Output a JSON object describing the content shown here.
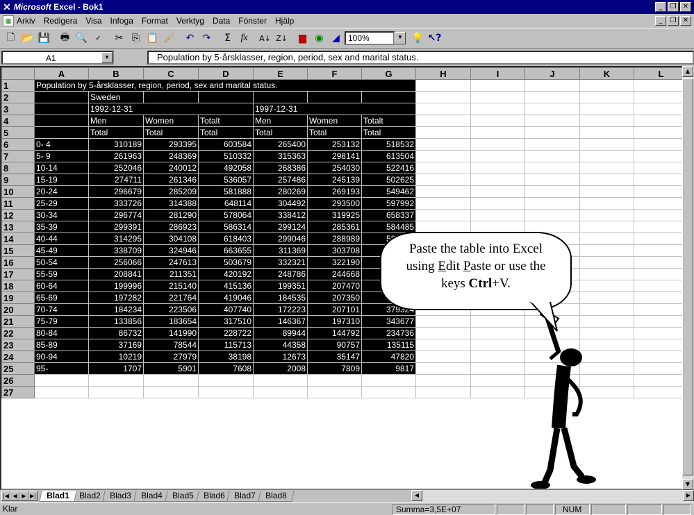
{
  "window": {
    "app": "Microsoft",
    "title_rest": " Excel - Bok1"
  },
  "menu": [
    "Arkiv",
    "Redigera",
    "Visa",
    "Infoga",
    "Format",
    "Verktyg",
    "Data",
    "Fönster",
    "Hjälp"
  ],
  "toolbar": {
    "zoom": "100%"
  },
  "formula": {
    "name": "A1",
    "content": "Population by 5-årsklasser, region, period, sex and marital status."
  },
  "columns": [
    "A",
    "B",
    "C",
    "D",
    "E",
    "F",
    "G",
    "H",
    "I",
    "J",
    "K",
    "L"
  ],
  "sheet": {
    "r1": "Population by 5-årsklasser, region, period, sex and marital status.",
    "r2b": "Sweden",
    "r3b": "1992-12-31",
    "r3e": "1997-12-31",
    "r4": [
      "Men",
      "Women",
      "Totalt",
      "Men",
      "Women",
      "Totalt"
    ],
    "r5": [
      "Total",
      "Total",
      "Total",
      "Total",
      "Total",
      "Total"
    ],
    "rows": [
      [
        "0- 4",
        "310189",
        "293395",
        "603584",
        "265400",
        "253132",
        "518532"
      ],
      [
        "5- 9",
        "261963",
        "248369",
        "510332",
        "315363",
        "298141",
        "613504"
      ],
      [
        "10-14",
        "252046",
        "240012",
        "492058",
        "268386",
        "254030",
        "522416"
      ],
      [
        "15-19",
        "274711",
        "261346",
        "536057",
        "257486",
        "245139",
        "502625"
      ],
      [
        "20-24",
        "296679",
        "285209",
        "581888",
        "280269",
        "269193",
        "549462"
      ],
      [
        "25-29",
        "333726",
        "314388",
        "648114",
        "304492",
        "293500",
        "597992"
      ],
      [
        "30-34",
        "296774",
        "281290",
        "578064",
        "338412",
        "319925",
        "658337"
      ],
      [
        "35-39",
        "299391",
        "286923",
        "586314",
        "299124",
        "285361",
        "584485"
      ],
      [
        "40-44",
        "314295",
        "304108",
        "618403",
        "299046",
        "288989",
        "588035"
      ],
      [
        "45-49",
        "338709",
        "324946",
        "663655",
        "311369",
        "303708",
        "615077"
      ],
      [
        "50-54",
        "256066",
        "247613",
        "503679",
        "332321",
        "322190",
        "654511"
      ],
      [
        "55-59",
        "208841",
        "211351",
        "420192",
        "248786",
        "244668",
        "493454"
      ],
      [
        "60-64",
        "199996",
        "215140",
        "415136",
        "199351",
        "207470",
        "406821"
      ],
      [
        "65-69",
        "197282",
        "221764",
        "419046",
        "184535",
        "207350",
        "391885"
      ],
      [
        "70-74",
        "184234",
        "223506",
        "407740",
        "172223",
        "207101",
        "379324"
      ],
      [
        "75-79",
        "133856",
        "183654",
        "317510",
        "146367",
        "197310",
        "343677"
      ],
      [
        "80-84",
        "86732",
        "141990",
        "228722",
        "89944",
        "144792",
        "234736"
      ],
      [
        "85-89",
        "37169",
        "78544",
        "115713",
        "44358",
        "90757",
        "135115"
      ],
      [
        "90-94",
        "10219",
        "27979",
        "38198",
        "12673",
        "35147",
        "47820"
      ],
      [
        "95-",
        "1707",
        "5901",
        "7608",
        "2008",
        "7809",
        "9817"
      ]
    ]
  },
  "tabs": [
    "Blad1",
    "Blad2",
    "Blad3",
    "Blad4",
    "Blad5",
    "Blad6",
    "Blad7",
    "Blad8"
  ],
  "callout": {
    "line1": "Paste the table into Excel",
    "line2_pre": "using ",
    "edit": "E",
    "edit_rest": "dit ",
    "paste": "P",
    "paste_rest": "aste or use the",
    "line3_pre": "keys ",
    "keys": "Ctrl",
    "line3_post": "+V."
  },
  "status": {
    "left": "Klar",
    "sum": "Summa=3,5E+07",
    "num": "NUM"
  }
}
